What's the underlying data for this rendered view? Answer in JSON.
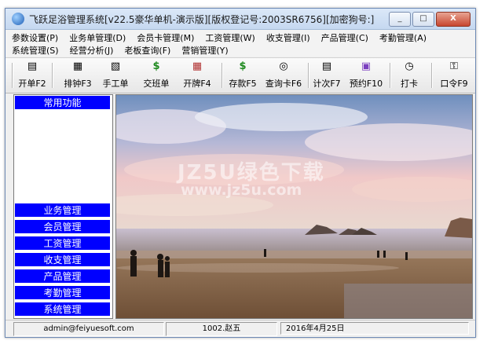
{
  "window": {
    "title": "飞跃足浴管理系统[v22.5豪华单机-演示版][版权登记号:2003SR6756][加密狗号:]",
    "minimize_glyph": "_",
    "maximize_glyph": "□",
    "close_glyph": "X"
  },
  "menu": {
    "row1": [
      "参数设置(P)",
      "业务单管理(D)",
      "会员卡管理(M)",
      "工资管理(W)",
      "收支管理(I)",
      "产品管理(C)",
      "考勤管理(A)"
    ],
    "row2": [
      "系统管理(S)",
      "经营分析(J)",
      "老板查询(F)",
      "营销管理(Y)"
    ]
  },
  "toolbar": [
    {
      "label": "开单F2",
      "icon": "document-icon",
      "glyph": "▤"
    },
    {
      "label": "排钟F3",
      "icon": "list-icon",
      "glyph": "▦"
    },
    {
      "label": "手工单",
      "icon": "form-icon",
      "glyph": "▧"
    },
    {
      "label": "交班单",
      "icon": "money-bag-icon",
      "glyph": "$"
    },
    {
      "label": "开牌F4",
      "icon": "grid-icon",
      "glyph": "▦"
    },
    {
      "label": "存款F5",
      "icon": "money-bag-icon",
      "glyph": "$"
    },
    {
      "label": "查询卡F6",
      "icon": "binoculars-icon",
      "glyph": "◎"
    },
    {
      "label": "计次F7",
      "icon": "counter-icon",
      "glyph": "▤"
    },
    {
      "label": "预约F10",
      "icon": "calendar-icon",
      "glyph": "▣"
    },
    {
      "label": "打卡",
      "icon": "clock-icon",
      "glyph": "◷"
    },
    {
      "label": "口令F9",
      "icon": "key-icon",
      "glyph": "⚿"
    }
  ],
  "sidebar": {
    "header": "常用功能",
    "items": [
      "业务管理",
      "会员管理",
      "工资管理",
      "收支管理",
      "产品管理",
      "考勤管理",
      "系统管理"
    ]
  },
  "watermark": {
    "line1": "JZ5U绿色下载",
    "line2": "www.jz5u.com"
  },
  "status": {
    "email": "admin@feiyuesoft.com",
    "user": "1002.赵五",
    "date": "2016年4月25日"
  },
  "colors": {
    "nav_blue": "#0000ff",
    "title_gradient": "#c5d8f0"
  }
}
